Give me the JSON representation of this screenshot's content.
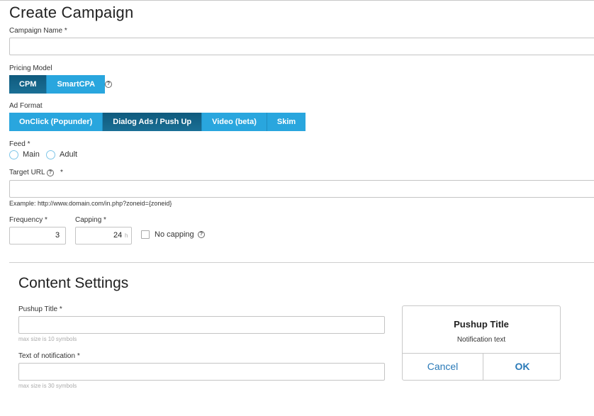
{
  "page": {
    "title": "Create Campaign"
  },
  "campaign_name": {
    "label": "Campaign Name",
    "value": ""
  },
  "pricing_model": {
    "label": "Pricing Model",
    "options": [
      "CPM",
      "SmartCPA"
    ],
    "selected": "CPM"
  },
  "ad_format": {
    "label": "Ad Format",
    "options": [
      "OnClick (Popunder)",
      "Dialog Ads / Push Up",
      "Video (beta)",
      "Skim"
    ],
    "selected": "Dialog Ads / Push Up"
  },
  "feed": {
    "label": "Feed",
    "options": [
      "Main",
      "Adult"
    ]
  },
  "target_url": {
    "label": "Target URL",
    "value": "",
    "example": "Example: http://www.domain.com/in.php?zoneid={zoneid}"
  },
  "frequency": {
    "label": "Frequency",
    "value": "3"
  },
  "capping": {
    "label": "Capping",
    "value": "24",
    "unit": "h"
  },
  "no_capping": {
    "label": "No capping"
  },
  "help_glyph": "?",
  "content_settings": {
    "title": "Content Settings",
    "pushup_title": {
      "label": "Pushup Title",
      "hint": "max size is 10 symbols",
      "value": ""
    },
    "notification_text": {
      "label": "Text of notification",
      "hint": "max size is 30 symbols",
      "value": ""
    }
  },
  "preview": {
    "title": "Pushup Title",
    "text": "Notification text",
    "cancel_label": "Cancel",
    "ok_label": "OK"
  },
  "colors": {
    "accent": "#29a6de",
    "active": "#135f84",
    "link": "#2a7ab8"
  },
  "icons": {
    "help": "question-circle-icon"
  }
}
